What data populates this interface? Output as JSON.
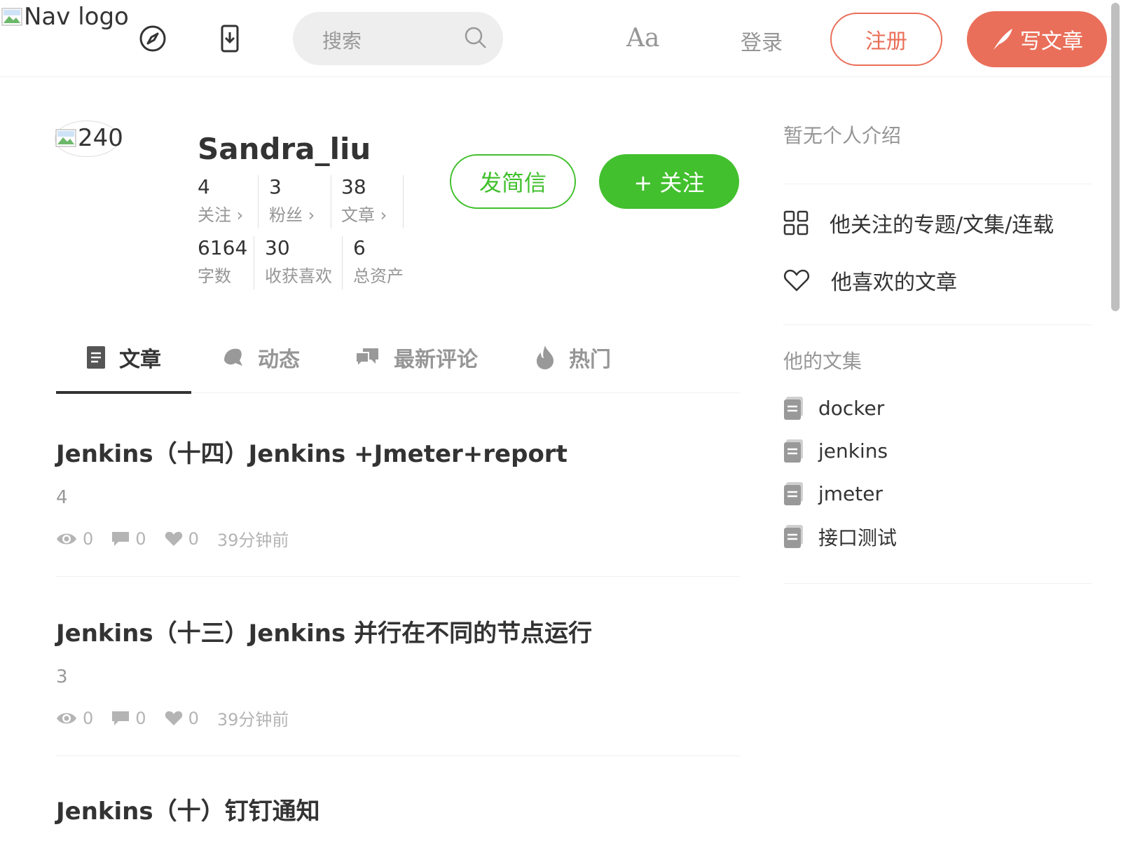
{
  "nav": {
    "logo_alt": "Nav logo",
    "search_placeholder": "搜索",
    "font_toggle": "Aa",
    "login": "登录",
    "signup": "注册",
    "write": "写文章",
    "accent_color": "#ea6f5a"
  },
  "profile": {
    "avatar_alt": "240",
    "username": "Sandra_liu",
    "stats_row1": [
      {
        "num": "4",
        "label": "关注 ›"
      },
      {
        "num": "3",
        "label": "粉丝 ›"
      },
      {
        "num": "38",
        "label": "文章 ›"
      }
    ],
    "stats_row2": [
      {
        "num": "6164",
        "label": "字数"
      },
      {
        "num": "30",
        "label": "收获喜欢"
      },
      {
        "num": "6",
        "label": "总资产"
      }
    ],
    "message_button": "发简信",
    "follow_button": "+ 关注",
    "follow_color": "#42c02e"
  },
  "tabs": [
    {
      "label": "文章",
      "icon": "document-icon",
      "active": true
    },
    {
      "label": "动态",
      "icon": "bell-icon",
      "active": false
    },
    {
      "label": "最新评论",
      "icon": "comments-icon",
      "active": false
    },
    {
      "label": "热门",
      "icon": "fire-icon",
      "active": false
    }
  ],
  "articles": [
    {
      "title": "Jenkins（十四）Jenkins +Jmeter+report",
      "abstract": "4",
      "views": "0",
      "comments": "0",
      "likes": "0",
      "time": "39分钟前"
    },
    {
      "title": "Jenkins（十三）Jenkins 并行在不同的节点运行",
      "abstract": "3",
      "views": "0",
      "comments": "0",
      "likes": "0",
      "time": "39分钟前"
    },
    {
      "title": "Jenkins（十）钉钉通知",
      "abstract": "",
      "views": "",
      "comments": "",
      "likes": "",
      "time": ""
    }
  ],
  "aside": {
    "intro": "暂无个人介绍",
    "links": [
      {
        "label": "他关注的专题/文集/连载",
        "icon": "grid-icon"
      },
      {
        "label": "他喜欢的文章",
        "icon": "heart-icon"
      }
    ],
    "collections_heading": "他的文集",
    "collections": [
      "docker",
      "jenkins",
      "jmeter",
      "接口测试"
    ]
  }
}
